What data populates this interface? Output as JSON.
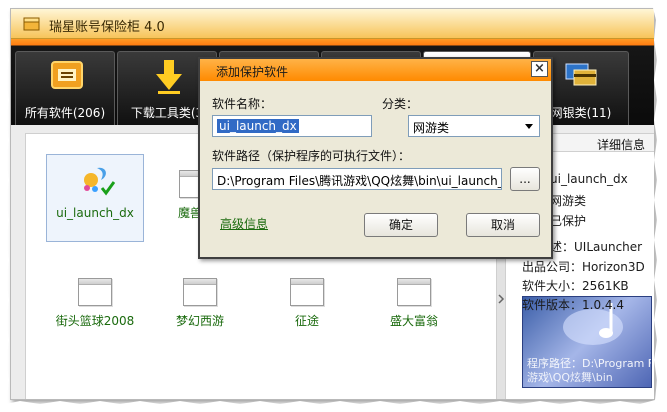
{
  "window": {
    "title": "瑞星账号保险柜 4.0"
  },
  "tabs": [
    {
      "label": "所有软件(206)",
      "icon": "software-icon"
    },
    {
      "label": "下载工具类(3",
      "icon": "download-arrow-icon"
    },
    {
      "label": "",
      "icon": ""
    },
    {
      "label": "",
      "icon": ""
    },
    {
      "label": "",
      "icon": ""
    },
    {
      "label": "网银类(11)",
      "icon": "bank-cards-icon"
    }
  ],
  "apps": [
    {
      "name": "ui_launch_dx",
      "selected": true
    },
    {
      "name": "魔兽世"
    },
    {
      "name": "街头篮球2008"
    },
    {
      "name": "梦幻西游"
    },
    {
      "name": "征途"
    },
    {
      "name": "盛大富翁"
    }
  ],
  "details": {
    "header": "详细信息",
    "lines": [
      "ui_launch_dx",
      "网游类",
      "已保护",
      "述：UILauncher",
      "出品公司：Horizon3D",
      "软件大小：2561KB",
      "软件版本：1.0.4.4"
    ],
    "promo_line1": "程序路径：D:\\Program F",
    "promo_line2": "游戏\\QQ炫舞\\bin"
  },
  "dialog": {
    "title": "添加保护软件",
    "close_label": "×",
    "name_label": "软件名称：",
    "name_value": "ui_launch_dx",
    "category_label": "分类：",
    "category_value": "网游类",
    "path_label": "软件路径（保护程序的可执行文件）：",
    "path_value": "D:\\Program Files\\腾讯游戏\\QQ炫舞\\bin\\ui_launch_dx.exe",
    "browse_label": "...",
    "advanced_label": "高级信息",
    "ok_label": "确定",
    "cancel_label": "取消"
  },
  "colors": {
    "accent": "#ff8a00",
    "link": "#1a6a0d",
    "selection": "#316ac5"
  }
}
